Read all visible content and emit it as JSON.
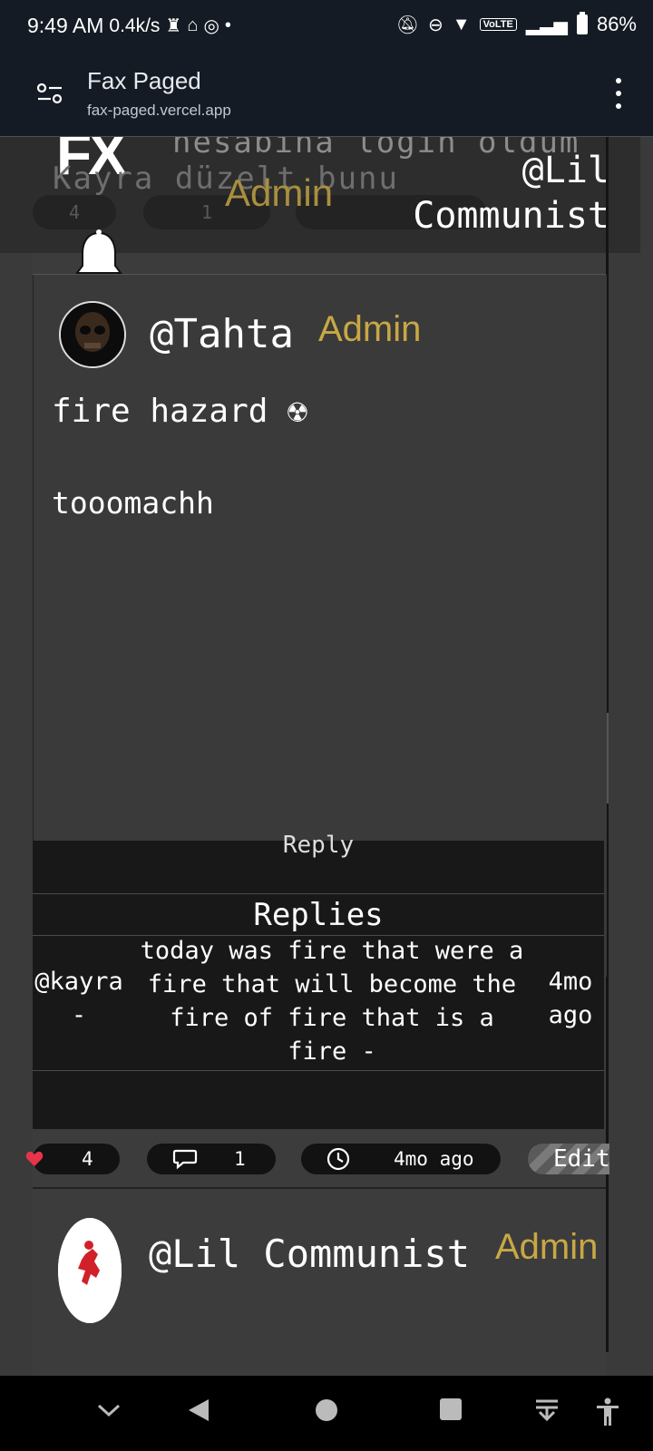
{
  "status_bar": {
    "time": "9:49 AM",
    "net_speed": "0.4k/s",
    "volte": "VoLTE",
    "battery": "86%"
  },
  "browser": {
    "title": "Fax Paged",
    "url": "fax-paged.vercel.app"
  },
  "sticky_header": {
    "logo_partial": "FX",
    "ghost_line1": "hesabına login oldum",
    "ghost_line2": "Kayra düzelt bunu",
    "ghost_pills": [
      "4",
      "1"
    ],
    "admin_badge": "Admin",
    "username": "@Lil Communist"
  },
  "post": {
    "username": "@Tahta",
    "admin_badge": "Admin",
    "title": "fire hazard ☢",
    "body": "tooomachh",
    "reply_link": "Reply",
    "replies_heading": "Replies",
    "replies": [
      {
        "author": "@kayra -",
        "text": "today was fire that were a fire that will become the fire of fire that is a fire -",
        "time": "4mo ago"
      }
    ],
    "actions": {
      "likes": "4",
      "comments": "1",
      "time": "4mo ago",
      "edit": "Edit"
    }
  },
  "next_post": {
    "username": "@Lil Communist",
    "admin_badge": "Admin"
  },
  "colors": {
    "admin_gold": "#c8a845",
    "heart": "#e8334a",
    "bar_bg": "#141b24"
  }
}
